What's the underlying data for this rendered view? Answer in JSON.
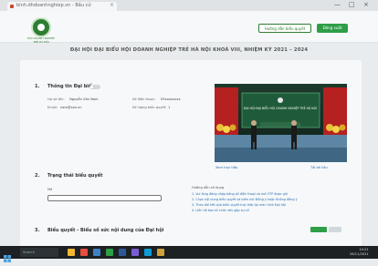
{
  "browser": {
    "tab_title": "binh.dhdoanhnghiep.vn - Bầu cử",
    "close_glyph": "×",
    "window_controls": [
      "—",
      "□",
      "×"
    ]
  },
  "header": {
    "logo_caption": "HỘI DOANH NGHIỆP TRẺ HÀ NỘI",
    "btn_secondary": "Hướng dẫn biểu quyết",
    "btn_primary": "Đăng xuất",
    "title": "ĐẠI HỘI ĐẠI BIỂU HỘI DOANH NGHIỆP TRẺ HÀ NỘI KHOÁ VIII, NHIỆM KỲ 2021 – 2024"
  },
  "section1": {
    "num": "1.",
    "title": "Thông tin Đại biểu",
    "rows": [
      {
        "label": "Họ và tên:",
        "value": "Nguyễn Văn Nam",
        "label2": "Số điện thoại:",
        "value2": "09xxxxxxxx"
      },
      {
        "label": "Email:",
        "value": "nam@xxx.vn",
        "label2": "Số lượng biểu quyết:",
        "value2": "1"
      }
    ]
  },
  "video": {
    "screen_text": "ĐẠI HỘI ĐẠI BIỂU HỘI DOANH NGHIỆP TRẺ HÀ NỘI",
    "link_left": "Xem trực tiếp",
    "link_right": "Tải tài liệu"
  },
  "section2": {
    "num": "2.",
    "title": "Trạng thái biểu quyết",
    "field_label": "Mã",
    "input_value": "",
    "hint_head": "Hướng dẫn sử dụng",
    "hints": [
      "1. Vui lòng đăng nhập bằng số điện thoại và mã OTP được gửi",
      "2. Chọn nội dung biểu quyết và bấm nút Đồng ý hoặc Không đồng ý",
      "3. Theo dõi kết quả biểu quyết trực tiếp tại màn hình Đại hội",
      "4. Liên hệ ban tổ chức nếu gặp sự cố"
    ]
  },
  "section3": {
    "num": "3.",
    "title": "Biểu quyết - Biểu số sức nội dung của Đại hội"
  },
  "taskbar": {
    "search": "Search",
    "time": "10:21",
    "date": "26/11/2021"
  },
  "colors": {
    "brand_green": "#2e9e47",
    "link_blue": "#2a6fb5",
    "taskbar": "#1d2124"
  }
}
